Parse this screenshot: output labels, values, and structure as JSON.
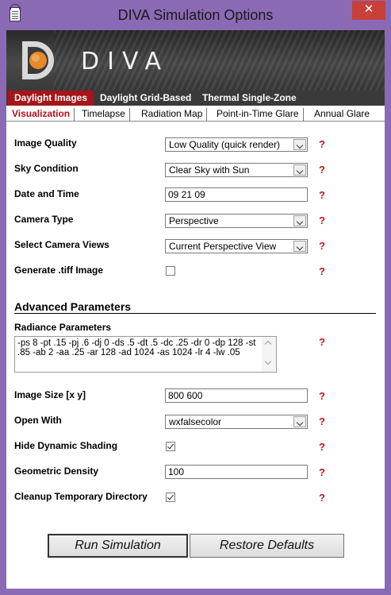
{
  "window": {
    "title": "DIVA Simulation Options",
    "close_label": "✕"
  },
  "banner": {
    "product": "DIVA"
  },
  "main_tabs": [
    {
      "label": "Daylight Images"
    },
    {
      "label": "Daylight Grid-Based"
    },
    {
      "label": "Thermal Single-Zone"
    }
  ],
  "sub_tabs": [
    {
      "label": "Visualization"
    },
    {
      "label": "Timelapse"
    },
    {
      "label": "Radiation Map"
    },
    {
      "label": "Point-in-Time Glare"
    },
    {
      "label": "Annual Glare"
    }
  ],
  "form": {
    "image_quality": {
      "label": "Image Quality",
      "value": "Low Quality (quick render)"
    },
    "sky_condition": {
      "label": "Sky Condition",
      "value": "Clear Sky with Sun"
    },
    "date_time": {
      "label": "Date and Time",
      "value": "09 21 09"
    },
    "camera_type": {
      "label": "Camera Type",
      "value": "Perspective"
    },
    "camera_views": {
      "label": "Select Camera Views",
      "value": "Current Perspective View"
    },
    "tiff": {
      "label": "Generate .tiff Image",
      "checked": false
    },
    "help": "?"
  },
  "advanced": {
    "title": "Advanced Parameters",
    "radiance_label": "Radiance Parameters",
    "radiance_value": "-ps 8 -pt .15 -pj .6 -dj 0 -ds .5 -dt .5 -dc .25 -dr 0 -dp 128 -st .85 -ab 2 -aa .25 -ar 128 -ad 1024 -as 1024 -lr 4 -lw .05",
    "image_size": {
      "label": "Image Size [x y]",
      "value": "800 600"
    },
    "open_with": {
      "label": "Open With",
      "value": "wxfalsecolor"
    },
    "hide_shading": {
      "label": "Hide Dynamic Shading",
      "checked": true
    },
    "geo_density": {
      "label": "Geometric Density",
      "value": "100"
    },
    "cleanup": {
      "label": "Cleanup Temporary Directory",
      "checked": true
    }
  },
  "buttons": {
    "run": "Run Simulation",
    "restore": "Restore Defaults"
  },
  "colors": {
    "accent_red": "#a5161a",
    "title_bar": "#8b6ab5",
    "help_red": "#c0161b"
  }
}
